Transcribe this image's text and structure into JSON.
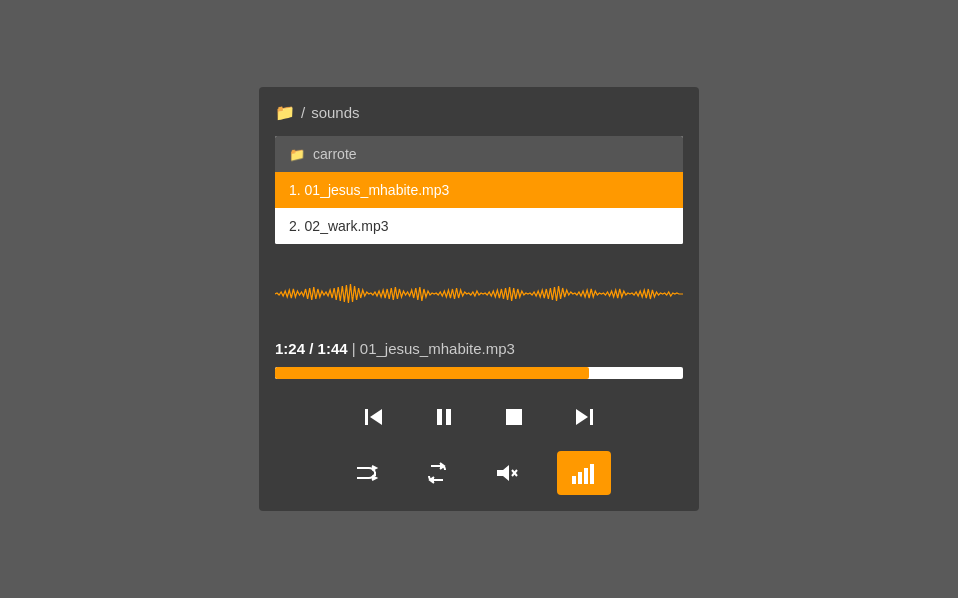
{
  "breadcrumb": {
    "separator": "/",
    "folder": "sounds"
  },
  "filelist": {
    "subfolder": "carrote",
    "tracks": [
      {
        "index": 1,
        "name": "01_jesus_mhabite.mp3",
        "active": true
      },
      {
        "index": 2,
        "name": "02_wark.mp3",
        "active": false
      }
    ]
  },
  "player": {
    "current_time": "1:24",
    "total_time": "1:44",
    "current_track": "01_jesus_mhabite.mp3",
    "progress_percent": 77
  },
  "controls": {
    "prev_label": "⏮",
    "pause_label": "⏸",
    "stop_label": "⏹",
    "next_label": "⏭",
    "shuffle_label": "⇄",
    "repeat_label": "↺",
    "mute_label": "🔇",
    "volume_label": "▐▌▌"
  }
}
